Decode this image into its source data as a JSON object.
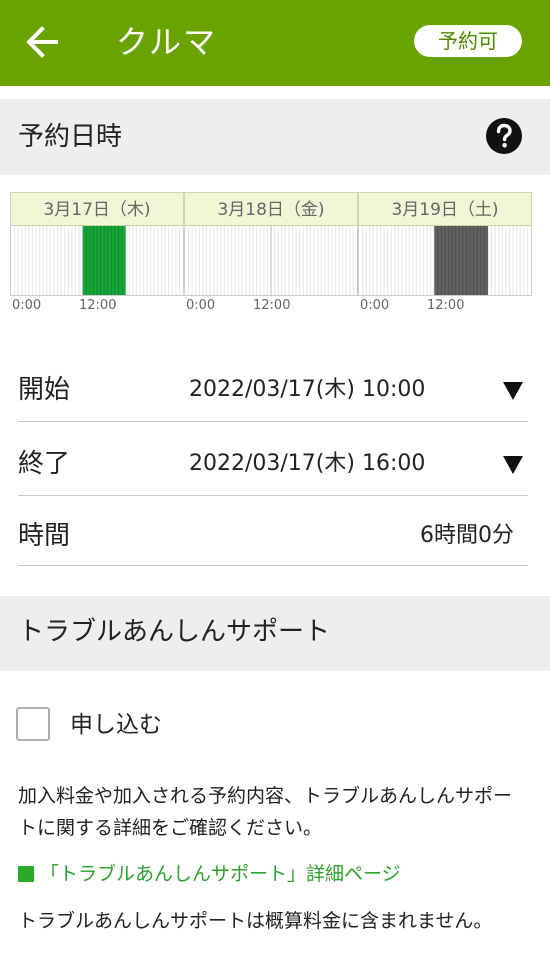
{
  "appbar": {
    "back_icon": "arrow-left-icon",
    "title": "クルマ",
    "status": "予約可",
    "color": "#6aa300"
  },
  "reservation": {
    "section_title": "予約日時",
    "help_icon": "question-circle-icon",
    "timeline": {
      "days": [
        {
          "label": "3月17日（木)",
          "reserved_hours": [
            10,
            16
          ],
          "reserved_color": "#17a53a"
        },
        {
          "label": "3月18日（金)",
          "reserved_hours": null,
          "reserved_color": null
        },
        {
          "label": "3月19日（土)",
          "reserved_hours": [
            10.5,
            18
          ],
          "reserved_color": "#616161"
        }
      ],
      "hour_labels": [
        "0:00",
        "12:00"
      ]
    },
    "start": {
      "label": "開始",
      "value": "2022/03/17(木) 10:00",
      "dropdown_icon": "triangle-down-icon"
    },
    "end": {
      "label": "終了",
      "value": "2022/03/17(木) 16:00",
      "dropdown_icon": "triangle-down-icon"
    },
    "duration": {
      "label": "時間",
      "value": "6時間0分"
    }
  },
  "support": {
    "section_title": "トラブルあんしんサポート",
    "apply": {
      "label": "申し込む",
      "checked": false
    },
    "description": "加入料金や加入される予約内容、トラブルあんしんサポートに関する詳細をご確認ください。",
    "link_text": "「トラブルあんしんサポート」詳細ページ",
    "link_color": "#2aa32a",
    "note": "トラブルあんしんサポートは概算料金に含まれません。"
  }
}
